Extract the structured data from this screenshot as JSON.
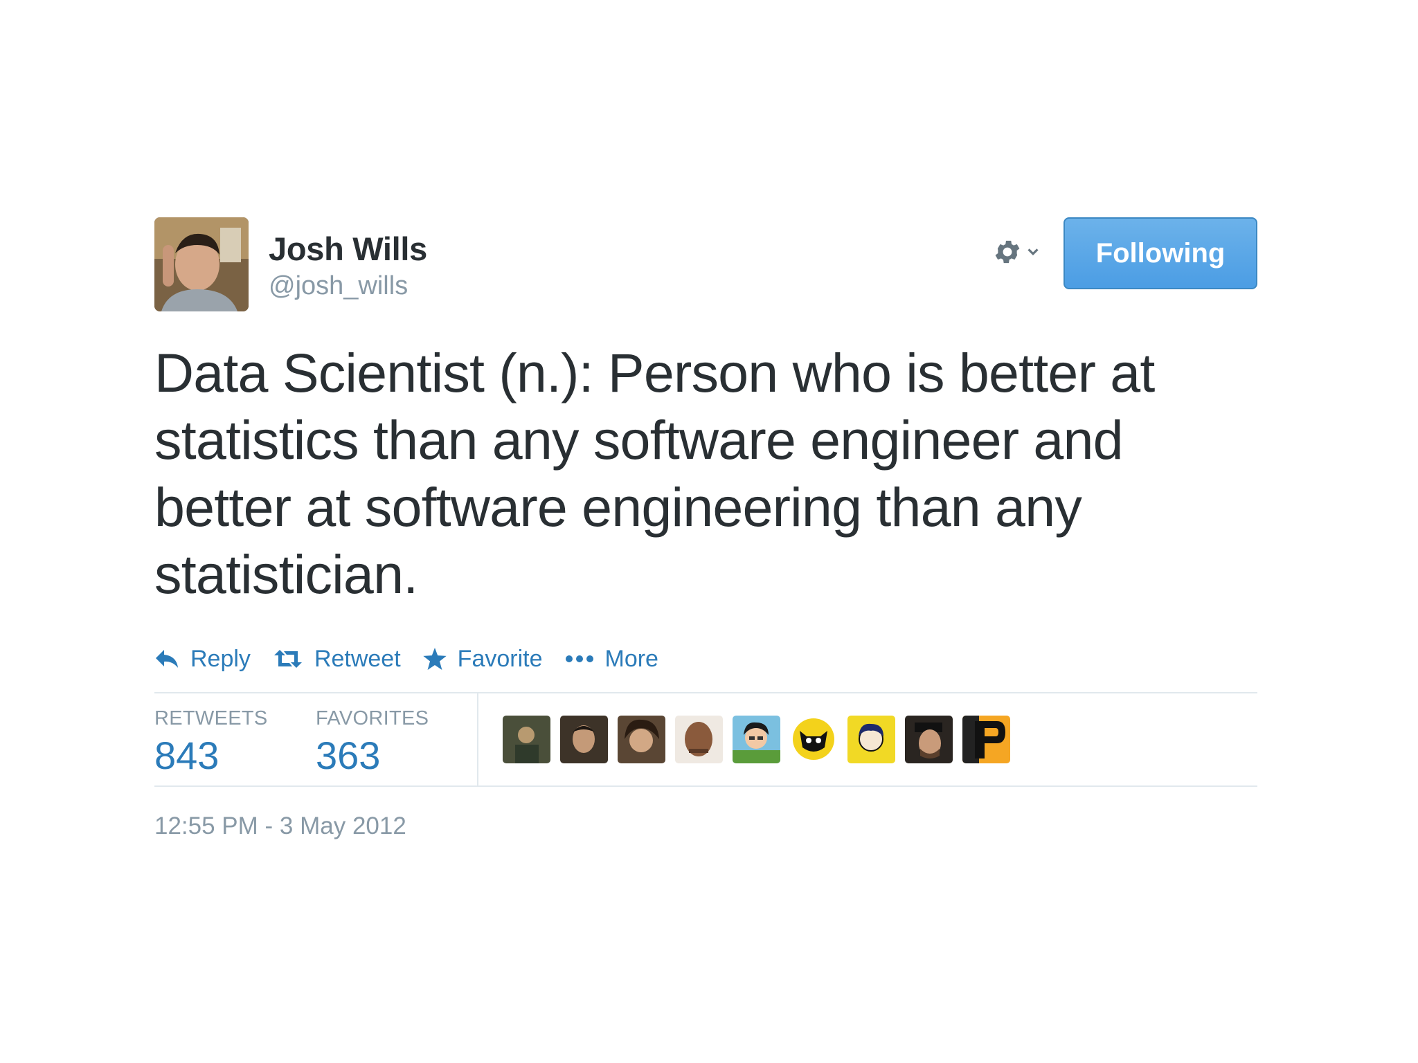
{
  "user": {
    "name": "Josh Wills",
    "handle": "@josh_wills"
  },
  "follow_button": "Following",
  "tweet_text": "Data Scientist (n.): Person who is better at statistics than any software engineer and better at software engineering than any statistician.",
  "actions": [
    {
      "label": "Reply",
      "icon": "reply-icon"
    },
    {
      "label": "Retweet",
      "icon": "retweet-icon"
    },
    {
      "label": "Favorite",
      "icon": "star-icon"
    },
    {
      "label": "More",
      "icon": "more-dots-icon"
    }
  ],
  "stats": {
    "retweets_label": "RETWEETS",
    "retweets_count": "843",
    "favorites_label": "FAVORITES",
    "favorites_count": "363"
  },
  "timestamp": "12:55 PM - 3 May 2012",
  "colors": {
    "link": "#2b7bb9",
    "muted": "#8899a6",
    "text": "#292f33",
    "button": "#55acee"
  }
}
